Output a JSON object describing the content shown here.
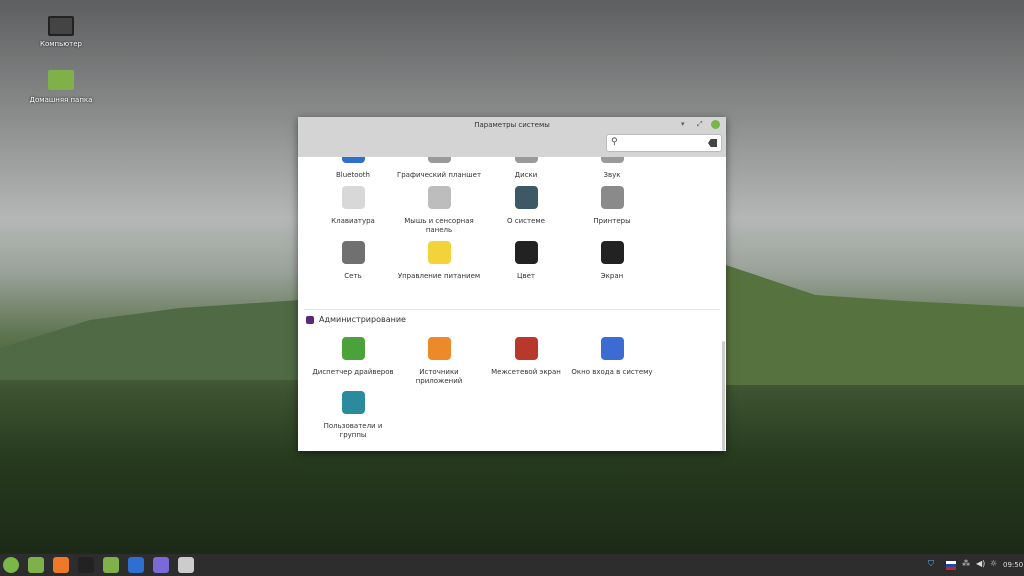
{
  "desktop": {
    "icons": [
      {
        "label": "Компьютер",
        "icon": "monitor-icon"
      },
      {
        "label": "Домашняя папка",
        "icon": "folder-icon"
      }
    ]
  },
  "window": {
    "title": "Параметры системы",
    "search": {
      "value": "",
      "placeholder": ""
    },
    "hardware_items": [
      {
        "label": "Bluetooth",
        "color": "#2f6fd1"
      },
      {
        "label": "Графический планшет",
        "color": "#9a9a9a"
      },
      {
        "label": "Диски",
        "color": "#9a9a9a"
      },
      {
        "label": "Звук",
        "color": "#9a9a9a"
      },
      {
        "label": "Клавиатура",
        "color": "#d8d8d8"
      },
      {
        "label": "Мышь и сенсорная панель",
        "color": "#bdbdbd"
      },
      {
        "label": "О системе",
        "color": "#3f5866"
      },
      {
        "label": "Принтеры",
        "color": "#8a8a8a"
      },
      {
        "label": "Сеть",
        "color": "#707070"
      },
      {
        "label": "Управление питанием",
        "color": "#f2d43a"
      },
      {
        "label": "Цвет",
        "color": "#222222"
      },
      {
        "label": "Экран",
        "color": "#222222"
      }
    ],
    "admin_section": {
      "title": "Администрирование",
      "color": "#5a2a72"
    },
    "admin_items": [
      {
        "label": "Диспетчер драйверов",
        "color": "#4ca23a"
      },
      {
        "label": "Источники приложений",
        "color": "#ec8a2a"
      },
      {
        "label": "Межсетевой экран",
        "color": "#b8392c"
      },
      {
        "label": "Окно входа в систему",
        "color": "#3c6bd4"
      },
      {
        "label": "Пользователи и группы",
        "color": "#2b8a9c"
      }
    ]
  },
  "taskbar": {
    "apps": [
      "mint-menu",
      "show-desktop",
      "firefox",
      "terminal",
      "files",
      "screenshot",
      "text-editor",
      "system-settings"
    ],
    "clock": "09:50",
    "keyboard_layout": "RU"
  }
}
